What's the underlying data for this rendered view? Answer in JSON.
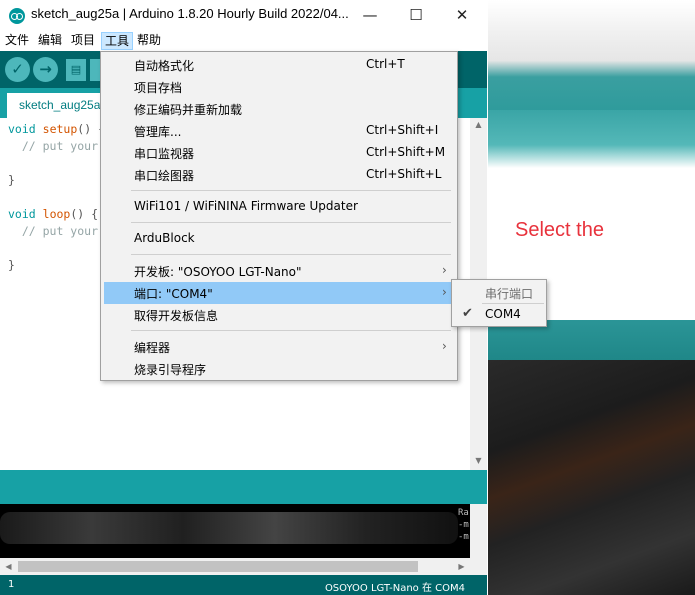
{
  "window": {
    "title": "sketch_aug25a | Arduino 1.8.20 Hourly Build 2022/04...",
    "minimize": "—",
    "maximize": "☐",
    "close": "✕"
  },
  "menubar": {
    "items": [
      "文件",
      "编辑",
      "项目",
      "工具",
      "帮助"
    ],
    "active": "工具"
  },
  "toolbar": {
    "icons": [
      "verify-icon",
      "upload-icon",
      "new-icon",
      "open-icon"
    ],
    "verify_glyph": "✓",
    "upload_glyph": "→",
    "new_glyph": "▤"
  },
  "tab": {
    "label": "sketch_aug25a"
  },
  "code": {
    "line1_kw": "void",
    "line1_fn": "setup",
    "line1_rest": "() {",
    "line2": "  // put your",
    "line3": "}",
    "line4_kw": "void",
    "line4_fn": "loop",
    "line4_rest": "() {",
    "line5": "  // put your",
    "line6": "}"
  },
  "tools_menu": {
    "items": [
      {
        "label": "自动格式化",
        "shortcut": "Ctrl+T"
      },
      {
        "label": "项目存档",
        "shortcut": ""
      },
      {
        "label": "修正编码并重新加载",
        "shortcut": ""
      },
      {
        "label": "管理库...",
        "shortcut": "Ctrl+Shift+I"
      },
      {
        "label": "串口监视器",
        "shortcut": "Ctrl+Shift+M"
      },
      {
        "label": "串口绘图器",
        "shortcut": "Ctrl+Shift+L"
      },
      {
        "label": "WiFi101 / WiFiNINA Firmware Updater",
        "shortcut": ""
      },
      {
        "label": "ArduBlock",
        "shortcut": ""
      },
      {
        "label": "开发板: \"OSOYOO LGT-Nano\"",
        "shortcut": "",
        "submenu": true
      },
      {
        "label": "端口: \"COM4\"",
        "shortcut": "",
        "submenu": true,
        "highlighted": true
      },
      {
        "label": "取得开发板信息",
        "shortcut": ""
      },
      {
        "label": "编程器",
        "shortcut": "",
        "submenu": true
      },
      {
        "label": "烧录引导程序",
        "shortcut": ""
      }
    ],
    "submenu_arrow": "›"
  },
  "port_submenu": {
    "header": "串行端口",
    "items": [
      {
        "label": "COM4",
        "checked": true
      }
    ],
    "check_glyph": "✔"
  },
  "console": {
    "fragment": "Ra\n-m\n-m"
  },
  "statusbar": {
    "line": "1",
    "board": "OSOYOO LGT-Nano 在 COM4"
  },
  "annotation": {
    "text": "Select the"
  },
  "colors": {
    "teal_dark": "#006468",
    "teal": "#17a1a5",
    "menu_highlight": "#91c9f7",
    "annotation_red": "#e8323c"
  }
}
